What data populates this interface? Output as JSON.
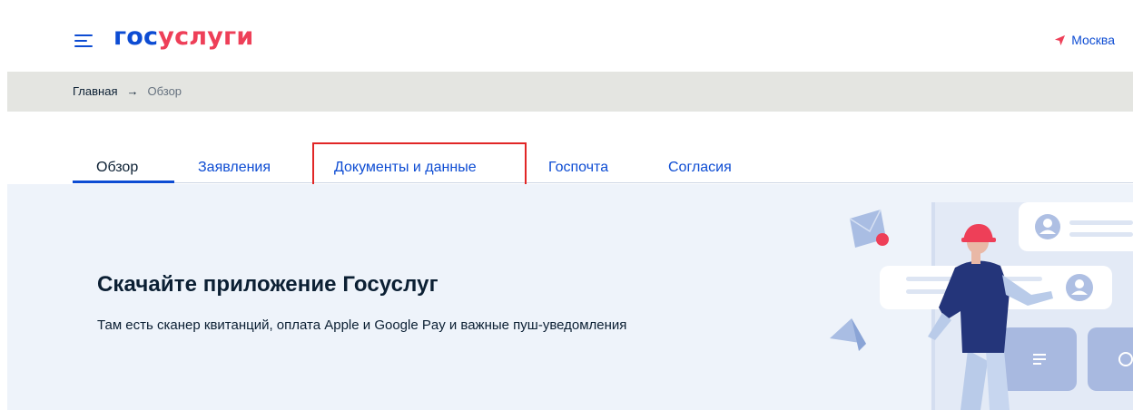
{
  "header": {
    "logo_part1": "гос",
    "logo_part2": "услуги",
    "menu_icon": "menu-icon",
    "location_icon": "location-arrow-icon",
    "location": "Москва"
  },
  "breadcrumb": {
    "home": "Главная",
    "separator": "→",
    "current": "Обзор"
  },
  "tabs": [
    {
      "label": "Обзор",
      "active": true
    },
    {
      "label": "Заявления",
      "active": false
    },
    {
      "label": "Документы и данные",
      "active": false,
      "highlighted": true
    },
    {
      "label": "Госпочта",
      "active": false
    },
    {
      "label": "Согласия",
      "active": false
    }
  ],
  "banner": {
    "title": "Скачайте приложение Госуслуг",
    "text": "Там есть сканер квитанций, оплата Apple и Google Pay и важные пуш-уведомления"
  },
  "colors": {
    "brand_blue": "#0d4cd3",
    "brand_red": "#ee3f58",
    "breadcrumb_bg": "#e4e5e1",
    "banner_bg": "#eef3fa",
    "highlight": "#e12626"
  }
}
